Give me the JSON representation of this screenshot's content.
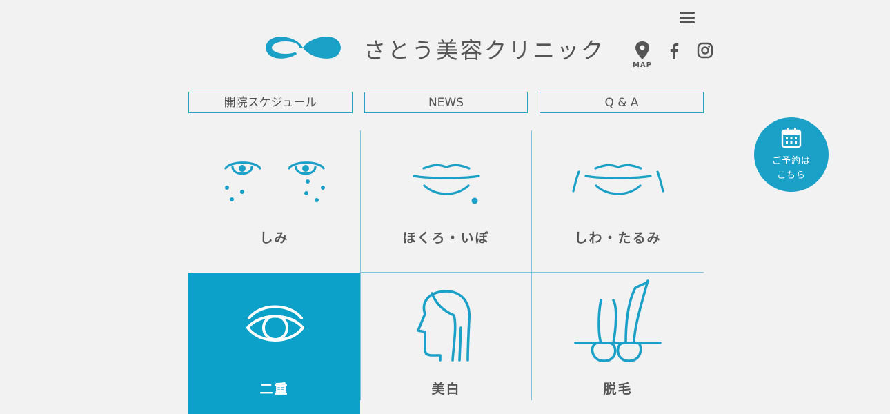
{
  "header": {
    "logo_text": "さとう美容クリニック",
    "menu_icon": "hamburger-menu-icon",
    "map_label": "MAP",
    "icons": [
      "map-pin-icon",
      "facebook-icon",
      "instagram-icon"
    ]
  },
  "nav": [
    {
      "label": "開院スケジュール"
    },
    {
      "label": "NEWS"
    },
    {
      "label": "Q & A"
    }
  ],
  "reserve": {
    "line1": "ご予約は",
    "line2": "こちら",
    "icon": "calendar-icon"
  },
  "menu": [
    {
      "label": "しみ",
      "icon": "spots-eyes-icon"
    },
    {
      "label": "ほくろ・いぼ",
      "icon": "mole-lips-icon"
    },
    {
      "label": "しわ・たるみ",
      "icon": "wrinkle-lips-icon"
    },
    {
      "label": "二重",
      "icon": "eye-icon",
      "active": true
    },
    {
      "label": "美白",
      "icon": "face-profile-icon"
    },
    {
      "label": "脱毛",
      "icon": "hair-removal-icon"
    }
  ],
  "colors": {
    "accent": "#0ba1c9",
    "border": "#2ea0c9",
    "background": "#f2f2f2",
    "text": "#555555"
  }
}
